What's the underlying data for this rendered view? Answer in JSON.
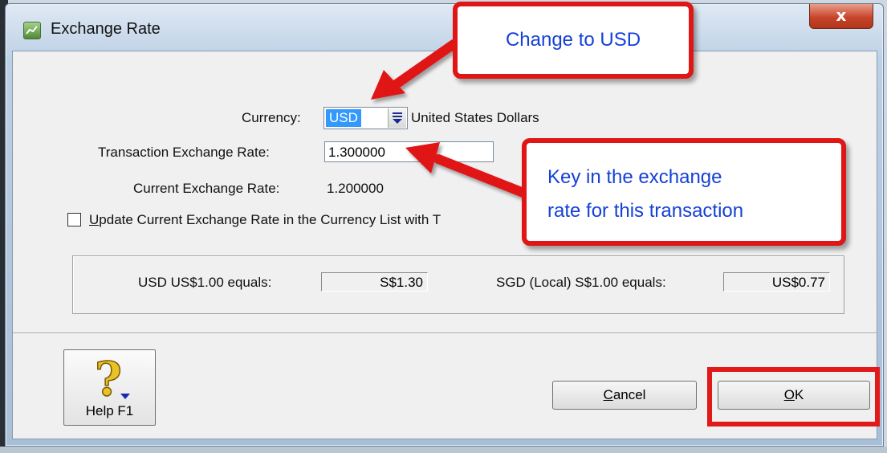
{
  "window": {
    "title": "Exchange Rate",
    "close_glyph": "x"
  },
  "form": {
    "currency_label": "Currency:",
    "currency_code": "USD",
    "currency_name": "United States Dollars",
    "transaction_rate_label": "Transaction Exchange Rate:",
    "transaction_rate_value": "1.300000",
    "current_rate_label": "Current Exchange Rate:",
    "current_rate_value": "1.200000",
    "update_checkbox_first": "U",
    "update_checkbox_rest": "pdate Current Exchange Rate in the Currency List with T",
    "update_checked": false
  },
  "conversion": {
    "foreign_label": "USD US$1.00 equals:",
    "foreign_value": "S$1.30",
    "local_label": "SGD (Local) S$1.00 equals:",
    "local_value": "US$0.77"
  },
  "buttons": {
    "help_label": "Help F1",
    "cancel_first": "",
    "cancel_accel": "C",
    "cancel_rest": "ancel",
    "ok_accel": "O",
    "ok_rest": "K"
  },
  "annotations": {
    "callout_top": "Change to USD",
    "callout_right_line1": "Key in the exchange",
    "callout_right_line2": "rate for this transaction"
  },
  "colors": {
    "annotation_red": "#e01515",
    "callout_text": "#1540d8",
    "selection_blue": "#3399ff"
  }
}
